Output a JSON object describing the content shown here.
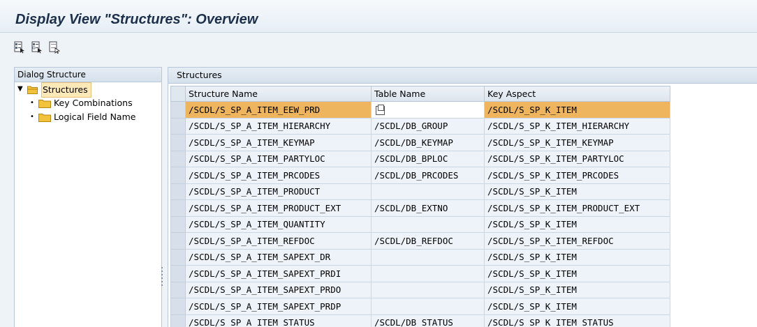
{
  "window": {
    "title": "Display View \"Structures\": Overview"
  },
  "toolbar": {
    "buttons": [
      {
        "name": "select-all-icon"
      },
      {
        "name": "select-block-icon"
      },
      {
        "name": "deselect-all-icon"
      }
    ]
  },
  "dialog_structure": {
    "header": "Dialog Structure",
    "items": [
      {
        "label": "Structures",
        "level": 0,
        "selected": true,
        "expanded": true
      },
      {
        "label": "Key Combinations",
        "level": 1,
        "selected": false
      },
      {
        "label": "Logical Field Name",
        "level": 1,
        "selected": false
      }
    ]
  },
  "structures": {
    "header": "Structures",
    "columns": [
      "Structure Name",
      "Table Name",
      "Key Aspect"
    ],
    "rows": [
      [
        "/SCDL/S_SP_A_ITEM_EEW_PRD",
        "",
        "/SCDL/S_SP_K_ITEM"
      ],
      [
        "/SCDL/S_SP_A_ITEM_HIERARCHY",
        "/SCDL/DB_GROUP",
        "/SCDL/S_SP_K_ITEM_HIERARCHY"
      ],
      [
        "/SCDL/S_SP_A_ITEM_KEYMAP",
        "/SCDL/DB_KEYMAP",
        "/SCDL/S_SP_K_ITEM_KEYMAP"
      ],
      [
        "/SCDL/S_SP_A_ITEM_PARTYLOC",
        "/SCDL/DB_BPLOC",
        "/SCDL/S_SP_K_ITEM_PARTYLOC"
      ],
      [
        "/SCDL/S_SP_A_ITEM_PRCODES",
        "/SCDL/DB_PRCODES",
        "/SCDL/S_SP_K_ITEM_PRCODES"
      ],
      [
        "/SCDL/S_SP_A_ITEM_PRODUCT",
        "",
        "/SCDL/S_SP_K_ITEM"
      ],
      [
        "/SCDL/S_SP_A_ITEM_PRODUCT_EXT",
        "/SCDL/DB_EXTNO",
        "/SCDL/S_SP_K_ITEM_PRODUCT_EXT"
      ],
      [
        "/SCDL/S_SP_A_ITEM_QUANTITY",
        "",
        "/SCDL/S_SP_K_ITEM"
      ],
      [
        "/SCDL/S_SP_A_ITEM_REFDOC",
        "/SCDL/DB_REFDOC",
        "/SCDL/S_SP_K_ITEM_REFDOC"
      ],
      [
        "/SCDL/S_SP_A_ITEM_SAPEXT_DR",
        "",
        "/SCDL/S_SP_K_ITEM"
      ],
      [
        "/SCDL/S_SP_A_ITEM_SAPEXT_PRDI",
        "",
        "/SCDL/S_SP_K_ITEM"
      ],
      [
        "/SCDL/S_SP_A_ITEM_SAPEXT_PRDO",
        "",
        "/SCDL/S_SP_K_ITEM"
      ],
      [
        "/SCDL/S_SP_A_ITEM_SAPEXT_PRDP",
        "",
        "/SCDL/S_SP_K_ITEM"
      ],
      [
        "/SCDL/S_SP_A_ITEM_STATUS",
        "/SCDL/DB_STATUS",
        "/SCDL/S_SP_K_ITEM_STATUS"
      ]
    ],
    "current_row": 0
  },
  "colors": {
    "current_row": "#efb45e",
    "tree_selection": "#fde8b7",
    "title_text": "#1c2f4a"
  }
}
